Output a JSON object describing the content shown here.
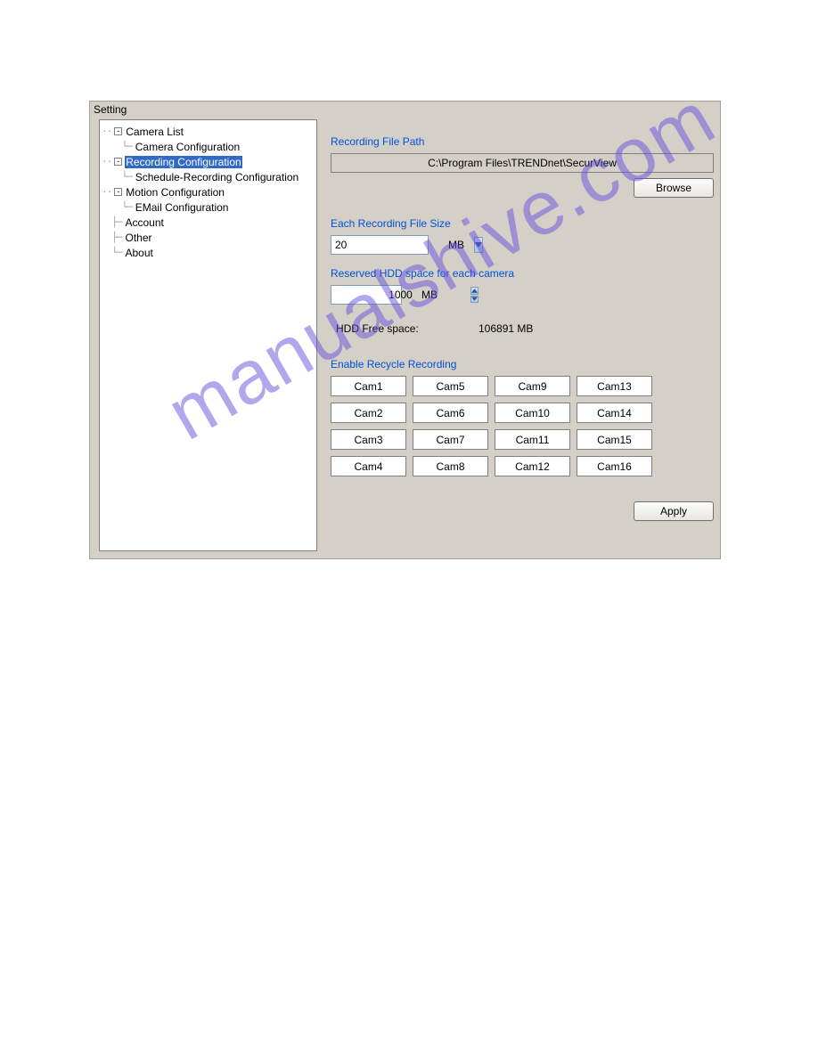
{
  "panel_title": "Setting",
  "tree": {
    "n0": "Camera List",
    "n0_0": "Camera Configuration",
    "n1": "Recording Configuration",
    "n1_0": "Schedule-Recording Configuration",
    "n2": "Motion Configuration",
    "n2_0": "EMail Configuration",
    "n3": "Account",
    "n4": "Other",
    "n5": "About",
    "minus": "-"
  },
  "labels": {
    "recording_file_path": "Recording File Path",
    "each_file_size": "Each Recording File Size",
    "reserved_hdd": "Reserved HDD space for each camera",
    "hdd_free": "HDD Free space:",
    "enable_recycle": "Enable Recycle Recording",
    "mb": "MB"
  },
  "values": {
    "file_path": "C:\\Program Files\\TRENDnet\\SecurView",
    "file_size": "20",
    "reserved": "1000",
    "hdd_free": "106891  MB"
  },
  "buttons": {
    "browse": "Browse",
    "apply": "Apply"
  },
  "cams": [
    "Cam1",
    "Cam2",
    "Cam3",
    "Cam4",
    "Cam5",
    "Cam6",
    "Cam7",
    "Cam8",
    "Cam9",
    "Cam10",
    "Cam11",
    "Cam12",
    "Cam13",
    "Cam14",
    "Cam15",
    "Cam16"
  ],
  "watermark": "manualshive.com"
}
